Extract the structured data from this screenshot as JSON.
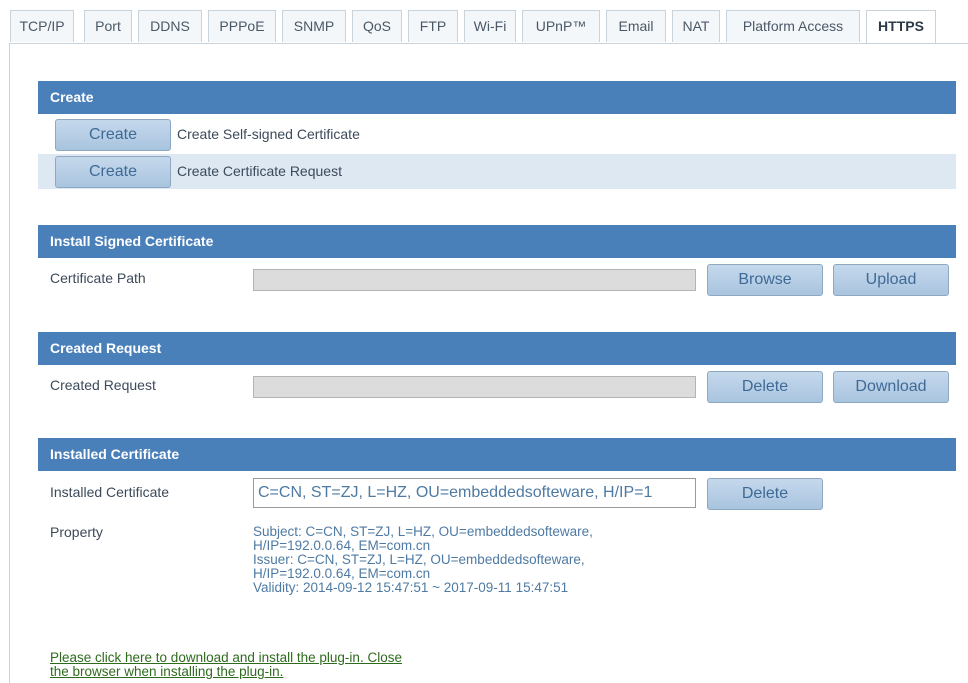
{
  "tabs": [
    "TCP/IP",
    "Port",
    "DDNS",
    "PPPoE",
    "SNMP",
    "QoS",
    "FTP",
    "Wi-Fi",
    "UPnP™",
    "Email",
    "NAT",
    "Platform Access",
    "HTTPS"
  ],
  "active_tab": "HTTPS",
  "create": {
    "header": "Create",
    "rows": [
      {
        "button": "Create",
        "label": "Create Self-signed Certificate"
      },
      {
        "button": "Create",
        "label": "Create Certificate Request"
      }
    ]
  },
  "install": {
    "header": "Install Signed Certificate",
    "label": "Certificate Path",
    "path_value": "",
    "browse": "Browse",
    "upload": "Upload"
  },
  "request": {
    "header": "Created Request",
    "label": "Created Request",
    "value": "",
    "delete": "Delete",
    "download": "Download"
  },
  "installed": {
    "header": "Installed Certificate",
    "label": "Installed Certificate",
    "value": "C=CN, ST=ZJ, L=HZ, OU=embeddedsofteware, H/IP=1",
    "delete": "Delete",
    "property_label": "Property",
    "property_lines": [
      "Subject: C=CN, ST=ZJ, L=HZ, OU=embeddedsofteware,",
      "H/IP=192.0.0.64, EM=com.cn",
      "Issuer: C=CN, ST=ZJ, L=HZ, OU=embeddedsofteware,",
      "H/IP=192.0.0.64, EM=com.cn",
      "Validity: 2014-09-12 15:47:51 ~ 2017-09-11 15:47:51"
    ]
  },
  "plugin_notice": {
    "line1": "Please click here to download and install the plug-in. Close",
    "line2": "the browser when installing the plug-in."
  },
  "colors": {
    "header_bg": "#4a80ba",
    "row_shade": "#dde8f3",
    "button_text": "#3f6a96",
    "link": "#2f6b1e"
  }
}
